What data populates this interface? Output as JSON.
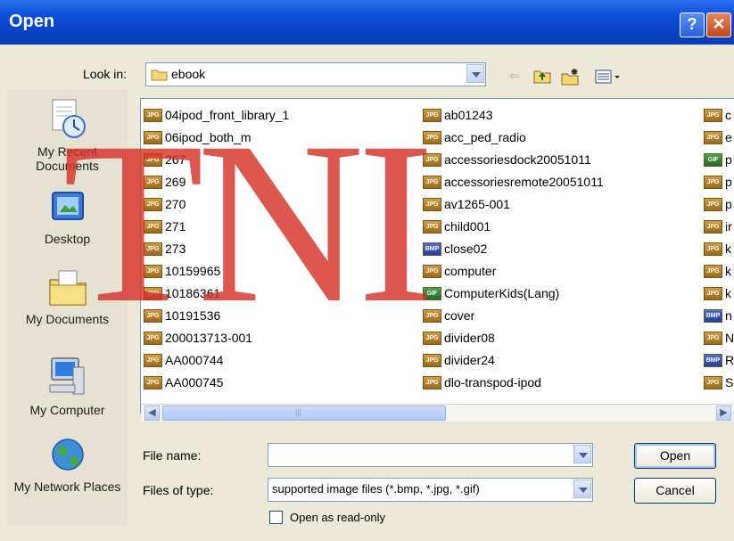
{
  "window": {
    "title": "Open",
    "help_glyph": "?",
    "close_glyph": "✕"
  },
  "lookin": {
    "label": "Look in:",
    "value": "ebook"
  },
  "places": [
    {
      "label": "My Recent Documents",
      "icon": "recent-documents-icon"
    },
    {
      "label": "Desktop",
      "icon": "desktop-icon"
    },
    {
      "label": "My Documents",
      "icon": "my-documents-icon"
    },
    {
      "label": "My Computer",
      "icon": "my-computer-icon"
    },
    {
      "label": "My Network Places",
      "icon": "network-places-icon"
    }
  ],
  "files": {
    "col1": [
      {
        "name": "04ipod_front_library_1",
        "type": "JPG"
      },
      {
        "name": "06ipod_both_m",
        "type": "JPG"
      },
      {
        "name": "267",
        "type": "JPG"
      },
      {
        "name": "269",
        "type": "JPG"
      },
      {
        "name": "270",
        "type": "JPG"
      },
      {
        "name": "271",
        "type": "JPG"
      },
      {
        "name": "273",
        "type": "JPG"
      },
      {
        "name": "10159965",
        "type": "JPG"
      },
      {
        "name": "10186361",
        "type": "JPG"
      },
      {
        "name": "10191536",
        "type": "JPG"
      },
      {
        "name": "200013713-001",
        "type": "JPG"
      },
      {
        "name": "AA000744",
        "type": "JPG"
      },
      {
        "name": "AA000745",
        "type": "JPG"
      }
    ],
    "col2": [
      {
        "name": "ab01243",
        "type": "JPG"
      },
      {
        "name": "acc_ped_radio",
        "type": "JPG"
      },
      {
        "name": "accessoriesdock20051011",
        "type": "JPG"
      },
      {
        "name": "accessoriesremote20051011",
        "type": "JPG"
      },
      {
        "name": "av1265-001",
        "type": "JPG"
      },
      {
        "name": "child001",
        "type": "JPG"
      },
      {
        "name": "close02",
        "type": "BMP"
      },
      {
        "name": "computer",
        "type": "JPG"
      },
      {
        "name": "ComputerKids(Lang)",
        "type": "GIF"
      },
      {
        "name": "cover",
        "type": "JPG"
      },
      {
        "name": "divider08",
        "type": "JPG"
      },
      {
        "name": "divider24",
        "type": "JPG"
      },
      {
        "name": "dlo-transpod-ipod",
        "type": "JPG"
      }
    ],
    "col3": [
      {
        "name": "c",
        "type": "JPG"
      },
      {
        "name": "e",
        "type": "JPG"
      },
      {
        "name": "p",
        "type": "GIF"
      },
      {
        "name": "p",
        "type": "JPG"
      },
      {
        "name": "p",
        "type": "JPG"
      },
      {
        "name": "ir",
        "type": "JPG"
      },
      {
        "name": "k",
        "type": "JPG"
      },
      {
        "name": "k",
        "type": "JPG"
      },
      {
        "name": "k",
        "type": "JPG"
      },
      {
        "name": "n",
        "type": "BMP"
      },
      {
        "name": "N",
        "type": "JPG"
      },
      {
        "name": "R",
        "type": "BMP"
      },
      {
        "name": "S",
        "type": "JPG"
      }
    ]
  },
  "filename": {
    "label": "File name:",
    "value": ""
  },
  "filetype": {
    "label": "Files of type:",
    "value": "supported image files (*.bmp, *.jpg, *.gif)"
  },
  "readonly": {
    "label": "Open as read-only"
  },
  "buttons": {
    "open": "Open",
    "cancel": "Cancel"
  },
  "watermark": {
    "text": "TNI"
  }
}
